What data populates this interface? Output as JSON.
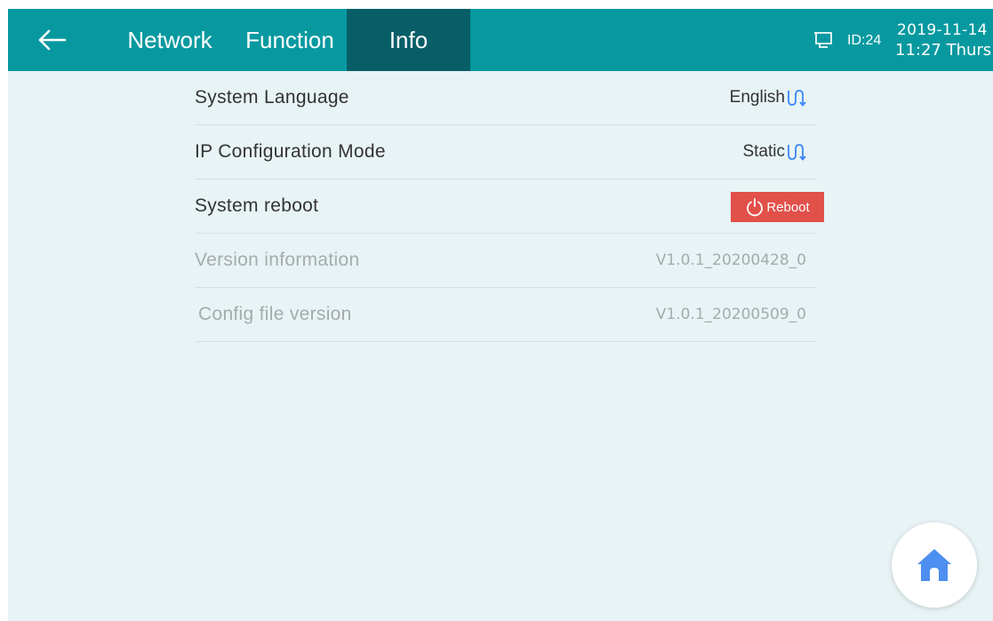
{
  "header": {
    "tabs": [
      {
        "label": "Network",
        "active": false
      },
      {
        "label": "Function",
        "active": false
      },
      {
        "label": "Info",
        "active": true
      }
    ],
    "device_id": "ID:24",
    "date": "2019-11-14",
    "time_day": "11:27 Thurs"
  },
  "settings": {
    "language": {
      "label": "System Language",
      "value": "English"
    },
    "ip_mode": {
      "label": "IP Configuration Mode",
      "value": "Static"
    },
    "reboot": {
      "label": "System reboot",
      "button_label": "Reboot"
    },
    "version": {
      "label": "Version information",
      "value": "V1.0.1_20200428_0"
    },
    "config": {
      "label": "Config file version",
      "value": "V1.0.1_20200509_0"
    }
  },
  "icons": {
    "back": "arrow-left-icon",
    "device": "monitor-icon",
    "switch": "switch-toggle-icon",
    "power": "power-icon",
    "home": "home-icon"
  },
  "colors": {
    "header": "#0899a0",
    "active_tab": "#075e67",
    "background": "#e8f3f5",
    "reboot": "#e2504a",
    "home_icon": "#4c8ff0",
    "switch_icon": "#3b86f7"
  }
}
